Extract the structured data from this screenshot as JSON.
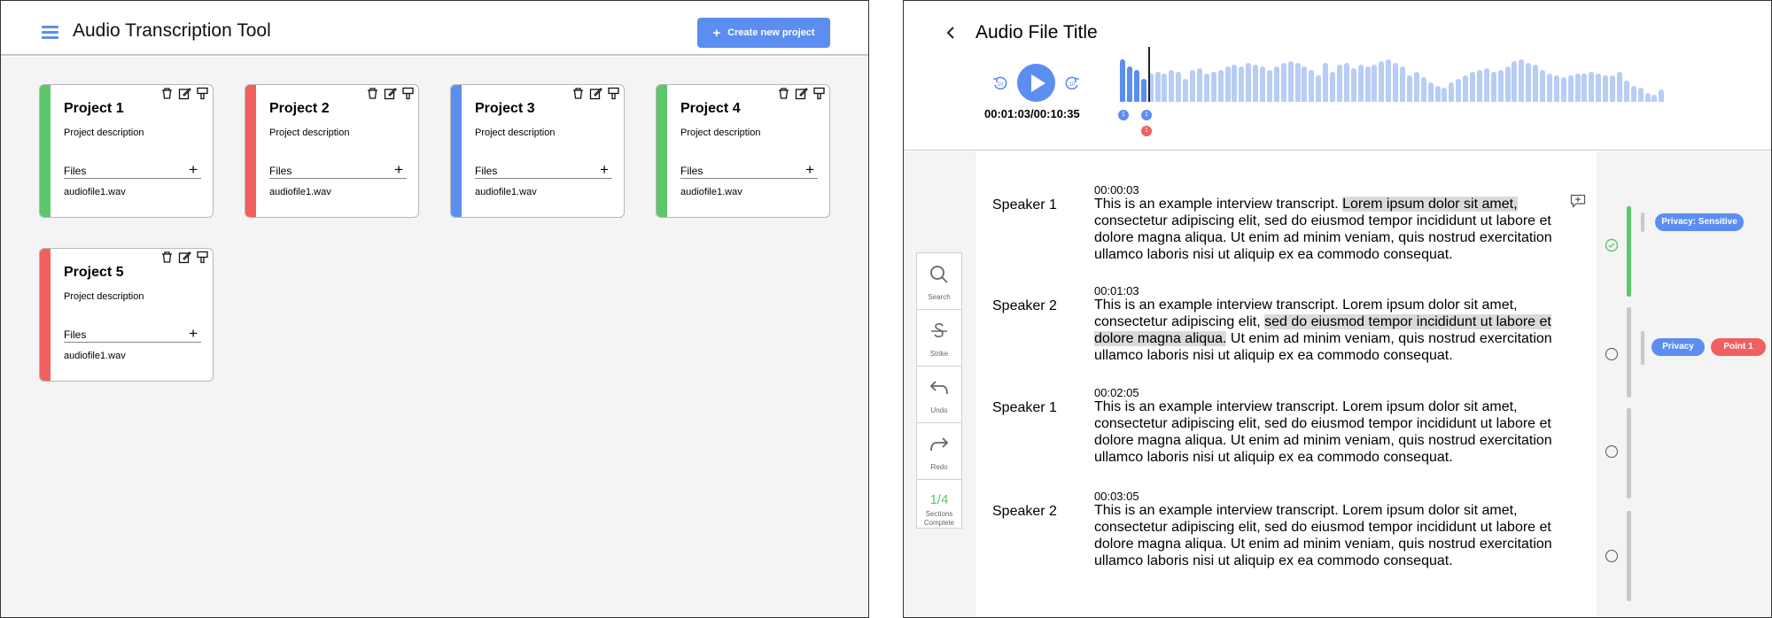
{
  "left": {
    "header": {
      "title": "Audio Transcription Tool",
      "create_label": "Create new project"
    },
    "projects": [
      {
        "title": "Project 1",
        "description": "Project description",
        "files_label": "Files",
        "file": "audiofile1.wav",
        "color": "#5cc76a"
      },
      {
        "title": "Project 2",
        "description": "Project description",
        "files_label": "Files",
        "file": "audiofile1.wav",
        "color": "#f06060"
      },
      {
        "title": "Project 3",
        "description": "Project description",
        "files_label": "Files",
        "file": "audiofile1.wav",
        "color": "#5b8ef0"
      },
      {
        "title": "Project 4",
        "description": "Project description",
        "files_label": "Files",
        "file": "audiofile1.wav",
        "color": "#5cc76a"
      },
      {
        "title": "Project 5",
        "description": "Project description",
        "files_label": "Files",
        "file": "audiofile1.wav",
        "color": "#f06060"
      }
    ]
  },
  "right": {
    "header": {
      "title": "Audio File Title",
      "time": "00:01:03/00:10:35"
    },
    "markers": [
      "1",
      "1",
      "1"
    ],
    "toolbar": {
      "search": "Search",
      "strike": "Strike",
      "undo": "Undo",
      "redo": "Redo",
      "sections_count": "1/4",
      "sections_label_1": "Sections",
      "sections_label_2": "Complete"
    },
    "transcript": [
      {
        "speaker": "Speaker 1",
        "time": "00:00:03",
        "pre": "This is an example interview transcript. ",
        "hl": "Lorem ipsum dolor sit amet,",
        "post": " consectetur adipiscing elit, sed do eiusmod tempor incididunt ut labore et dolore magna aliqua. Ut enim ad minim veniam, quis nostrud exercitation ullamco laboris nisi ut aliquip ex ea commodo consequat."
      },
      {
        "speaker": "Speaker 2",
        "time": "00:01:03",
        "pre": "This is an example interview transcript. Lorem ipsum dolor sit amet, consectetur adipiscing elit, ",
        "hl": "sed do eiusmod tempor incididunt ut labore et dolore magna aliqua.",
        "post": " Ut enim ad minim veniam, quis nostrud exercitation ullamco laboris nisi ut aliquip ex ea commodo consequat."
      },
      {
        "speaker": "Speaker 1",
        "time": "00:02:05",
        "pre": "This is an example interview transcript. Lorem ipsum dolor sit amet, consectetur adipiscing elit, sed do eiusmod tempor incididunt ut labore et dolore magna aliqua. Ut enim ad minim veniam, quis nostrud exercitation ullamco laboris nisi ut aliquip ex ea commodo consequat.",
        "hl": "",
        "post": ""
      },
      {
        "speaker": "Speaker 2",
        "time": "00:03:05",
        "pre": "This is an example interview transcript. Lorem ipsum dolor sit amet, consectetur adipiscing elit, sed do eiusmod tempor incididunt ut labore et dolore magna aliqua. Ut enim ad minim veniam, quis nostrud exercitation ullamco laboris nisi ut aliquip ex ea commodo consequat.",
        "hl": "",
        "post": ""
      }
    ],
    "tags": {
      "privacy_sensitive": "Privacy: Sensitive",
      "privacy": "Privacy",
      "point1": "Point 1"
    },
    "colors": {
      "accent": "#5b8ef0",
      "green": "#5cc76a",
      "red": "#f06060"
    }
  }
}
